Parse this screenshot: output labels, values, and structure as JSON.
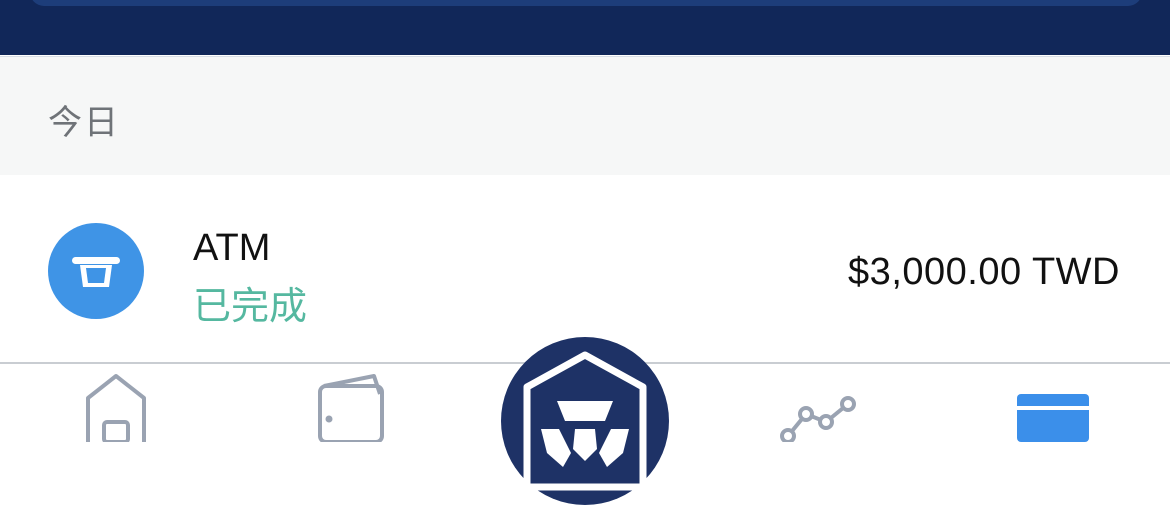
{
  "header": {
    "background": "#112759"
  },
  "section": {
    "title": "今日"
  },
  "transaction": {
    "title": "ATM",
    "status": "已完成",
    "amount": "$3,000.00 TWD",
    "icon": "atm-icon",
    "icon_color": "#3f94e6",
    "status_color": "#55b8a0"
  },
  "bottom_nav": {
    "items": [
      {
        "icon": "home-icon"
      },
      {
        "icon": "wallet-icon"
      },
      {
        "icon": "crypto-lion-icon"
      },
      {
        "icon": "trend-chart-icon"
      },
      {
        "icon": "card-icon"
      }
    ],
    "active_color": "#3b8fea",
    "inactive_color": "#9aa3b2"
  }
}
